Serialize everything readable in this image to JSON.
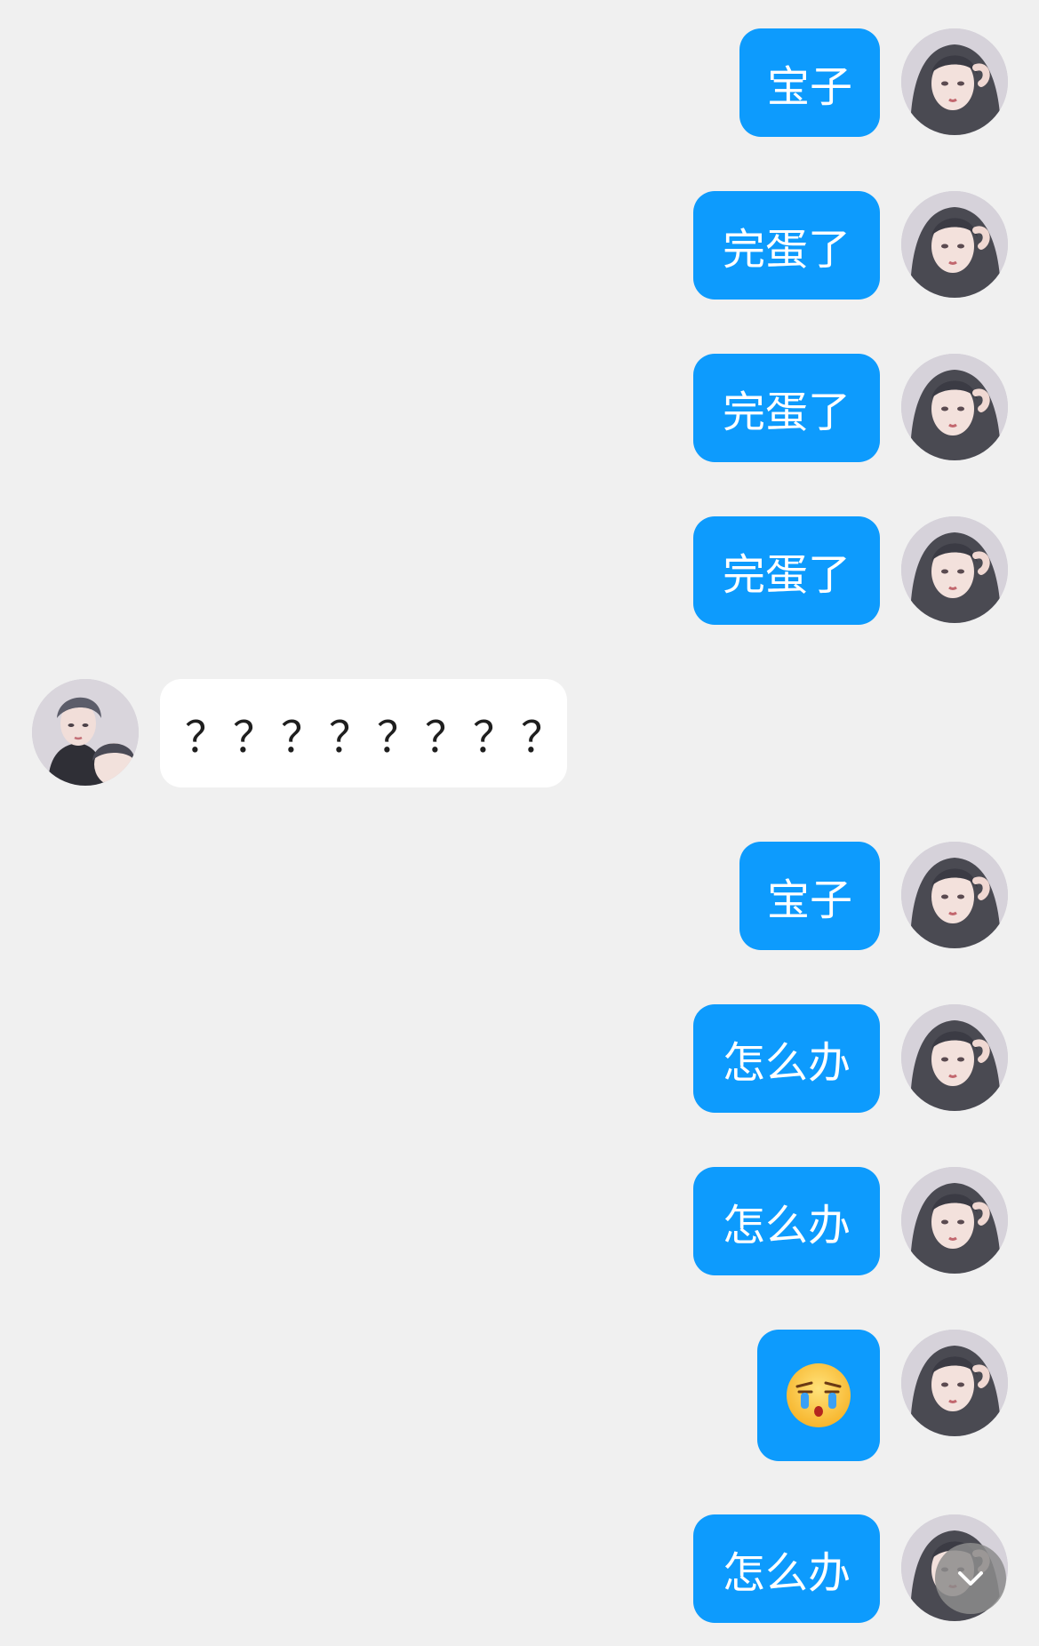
{
  "messages": [
    {
      "side": "me",
      "text": "宝子"
    },
    {
      "side": "me",
      "text": "完蛋了"
    },
    {
      "side": "me",
      "text": "完蛋了"
    },
    {
      "side": "me",
      "text": "完蛋了"
    },
    {
      "side": "them",
      "text": "？？？？？？？？"
    },
    {
      "side": "me",
      "text": "宝子"
    },
    {
      "side": "me",
      "text": "怎么办"
    },
    {
      "side": "me",
      "text": "怎么办"
    },
    {
      "side": "me",
      "emoji": "crying-face-emoji"
    },
    {
      "side": "me",
      "text": "怎么办"
    }
  ],
  "colors": {
    "background": "#f0f0f0",
    "my_bubble": "#0d9bfd",
    "their_bubble": "#ffffff",
    "scroll_button": "#8c8c8c"
  },
  "icons": {
    "scroll_down": "chevron-down-icon"
  }
}
